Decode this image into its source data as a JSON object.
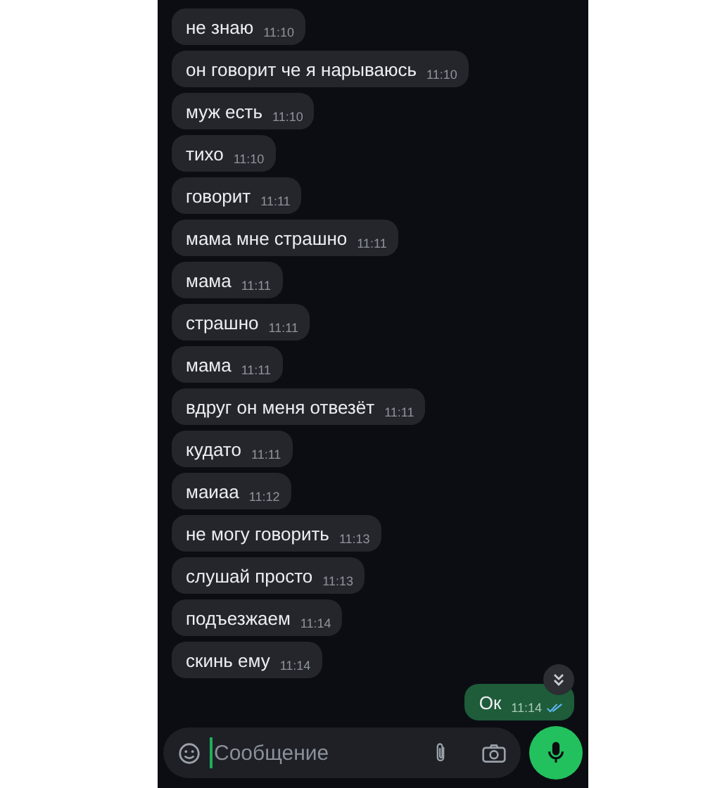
{
  "messages": [
    {
      "kind": "incoming",
      "text": "не знаю",
      "time": "11:10"
    },
    {
      "kind": "incoming",
      "text": "он говорит че я нарываюсь",
      "time": "11:10"
    },
    {
      "kind": "incoming",
      "text": "муж есть",
      "time": "11:10"
    },
    {
      "kind": "incoming",
      "text": "тихо",
      "time": "11:10"
    },
    {
      "kind": "incoming",
      "text": "говорит",
      "time": "11:11"
    },
    {
      "kind": "incoming",
      "text": "мама мне страшно",
      "time": "11:11"
    },
    {
      "kind": "incoming",
      "text": "мама",
      "time": "11:11"
    },
    {
      "kind": "incoming",
      "text": "страшно",
      "time": "11:11"
    },
    {
      "kind": "incoming",
      "text": "мама",
      "time": "11:11"
    },
    {
      "kind": "incoming",
      "text": "вдруг он меня отвезёт",
      "time": "11:11"
    },
    {
      "kind": "incoming",
      "text": "кудато",
      "time": "11:11"
    },
    {
      "kind": "incoming",
      "text": "маиаа",
      "time": "11:12"
    },
    {
      "kind": "incoming",
      "text": "не могу говорить",
      "time": "11:13"
    },
    {
      "kind": "incoming",
      "text": "слушай просто",
      "time": "11:13"
    },
    {
      "kind": "incoming",
      "text": "подъезжаем",
      "time": "11:14"
    },
    {
      "kind": "incoming",
      "text": "скинь ему",
      "time": "11:14"
    },
    {
      "kind": "outgoing",
      "text": "Ок",
      "time": "11:14",
      "read": true
    }
  ],
  "composer": {
    "placeholder": "Сообщение"
  }
}
